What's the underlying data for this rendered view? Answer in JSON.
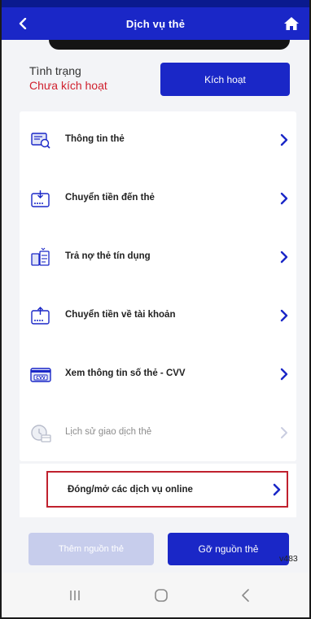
{
  "header": {
    "title": "Dịch vụ thẻ",
    "back_icon": "chevron-left-icon",
    "home_icon": "home-icon",
    "bg_color": "#1a27c7"
  },
  "status": {
    "label": "Tình trạng",
    "value": "Chưa kích hoạt",
    "value_color": "#d0212e",
    "activate_button": "Kích hoạt"
  },
  "menu": {
    "items": [
      {
        "label": "Thông tin thẻ",
        "icon": "card-info-icon",
        "enabled": true
      },
      {
        "label": "Chuyển tiền đến thẻ",
        "icon": "transfer-to-card-icon",
        "enabled": true
      },
      {
        "label": "Trả nợ thẻ tín dụng",
        "icon": "credit-payment-icon",
        "enabled": true
      },
      {
        "label": "Chuyển tiền về tài khoản",
        "icon": "transfer-to-account-icon",
        "enabled": true
      },
      {
        "label": "Xem thông tin số thẻ - CVV",
        "icon": "cvv-icon",
        "enabled": true
      },
      {
        "label": "Lịch sử giao dịch thẻ",
        "icon": "history-icon",
        "enabled": false
      }
    ],
    "online_services": "Đóng/mở các dịch vụ online"
  },
  "actions": {
    "add_source": "Thêm nguồn thẻ",
    "remove_source": "Gỡ nguồn thẻ",
    "version": "v483"
  },
  "navbar": {
    "recents_icon": "recents-icon",
    "home_icon": "circle-home-icon",
    "back_icon": "back-arrow-icon"
  }
}
